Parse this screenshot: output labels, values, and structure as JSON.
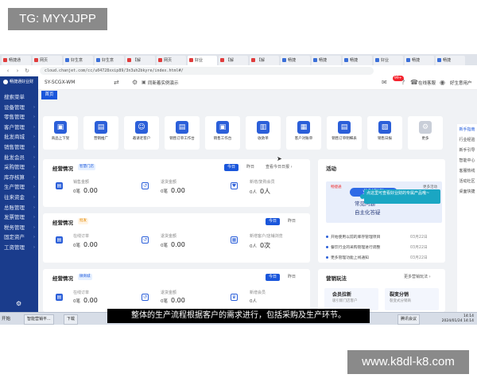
{
  "watermark_top": "TG: MYYJJPP",
  "watermark_bottom": "www.k8dl-k8.com",
  "subtitle": "整体的生产流程根据客户的需求进行，包括采购及生产环节。",
  "browser": {
    "tabs": [
      {
        "label": "畅捷通",
        "color": "#e03c3c"
      },
      {
        "label": "网页",
        "color": "#e03c3c"
      },
      {
        "label": "好生意",
        "color": "#3b6fd8"
      },
      {
        "label": "好生意",
        "color": "#3b6fd8"
      },
      {
        "label": "【解",
        "color": "#e03c3c"
      },
      {
        "label": "网页",
        "color": "#e03c3c"
      },
      {
        "label": "好业",
        "color": "#e03c3c"
      },
      {
        "label": "【解",
        "color": "#e03c3c"
      },
      {
        "label": "【解",
        "color": "#e03c3c"
      },
      {
        "label": "畅捷",
        "color": "#3b6fd8"
      },
      {
        "label": "畅捷",
        "color": "#3b6fd8"
      },
      {
        "label": "畅捷",
        "color": "#3b6fd8"
      },
      {
        "label": "好业",
        "color": "#3b6fd8"
      },
      {
        "label": "畅捷",
        "color": "#3b6fd8"
      },
      {
        "label": "畅捷",
        "color": "#3b6fd8"
      }
    ],
    "url": "cloud.chanjet.com/cc/u04728xxip89/3n3uh2bkyre/index.html#/"
  },
  "sidebar": {
    "logo": "畅捷通好业财",
    "items": [
      "搜索菜单",
      "设备管理",
      "零售管理",
      "客户管理",
      "批发商城",
      "销售管理",
      "批发会员",
      "采购管理",
      "库存核算",
      "生产管理",
      "往来资金",
      "总账管理",
      "发票管理",
      "税务管理",
      "固定资产",
      "工资管理"
    ]
  },
  "topbar": {
    "company": "SY-SCGX-WM",
    "demo": "同新着实例演示",
    "badge": "99+",
    "online_service": "在线客服",
    "user": "好生意用户"
  },
  "subtab": "首页",
  "quick_items": [
    "商品上下架",
    "营销推广",
    "邀请老客户",
    "销售订单工作台",
    "销售工作台",
    "收款单",
    "客户对账单",
    "销售订单明细表",
    "销售日报",
    "更多"
  ],
  "cards": {
    "c1": {
      "title": "经营情况",
      "tag": "智慧门店",
      "btn_today": "今日",
      "btn_yesterday": "昨日",
      "btn_more": "查看今日日报 ›",
      "m1_label": "销售金额",
      "m1_count": "0笔",
      "m1_value": "0.00",
      "m2_label": "退货金额",
      "m2_count": "0笔",
      "m2_value": "0.00",
      "m3_label": "新增/复购会员",
      "m3_count": "0人",
      "m3_value": "0人"
    },
    "c2": {
      "title": "经营情况",
      "tag": "批发",
      "btn_today": "今日",
      "btn_yesterday": "昨日",
      "m1_label": "在线订单",
      "m1_count": "0笔",
      "m1_value": "0.00",
      "m2_label": "退货金额",
      "m2_count": "0笔",
      "m2_value": "0.00",
      "m3_label": "新增客户/店铺浏览",
      "m3_count": "0人",
      "m3_value": "0次"
    },
    "c3": {
      "title": "经营情况",
      "tag": "微商城",
      "btn_today": "今日",
      "btn_yesterday": "昨日",
      "m1_label": "在线订单",
      "m1_count": "0笔",
      "m1_value": "0.00",
      "m2_label": "退货金额",
      "m2_count": "0笔",
      "m2_value": "0.00",
      "m3_label": "新增会员",
      "m3_count": "0人",
      "m3_value": ""
    }
  },
  "activity": {
    "title": "活动",
    "banner_brand": "畅捷通",
    "banner_tag": "更多活动",
    "banner_line1": "业财联动",
    "banner_line2": "常见问题",
    "banner_line3": "自主化答疑",
    "news": [
      {
        "text": "开始使用以前的库存管理项目",
        "date": "03月22日"
      },
      {
        "text": "餐饮行业的采购管理进行调整",
        "date": "03月22日"
      },
      {
        "text": "更多管理功能上线通知",
        "date": "03月22日"
      }
    ]
  },
  "marketing": {
    "title": "营销玩法",
    "more": "更多营销玩法 ›",
    "item1": "会员拉新",
    "item1_sub": "吸引新门店客户",
    "item2": "裂变分销",
    "item2_sub": "裂变式分销商"
  },
  "right_panel": [
    "新手指南",
    "行业经验",
    "新手引导",
    "智能中心",
    "客服热线",
    "活动社区",
    "桌面快捷"
  ],
  "tooltip": "点这里可查看好业财的专属产品哦~",
  "taskbar": {
    "start": "开始",
    "items": [
      "智能营销平...",
      "下载",
      "腾讯会议"
    ],
    "time": "14:14",
    "date": "2024/01/24 14:14"
  }
}
